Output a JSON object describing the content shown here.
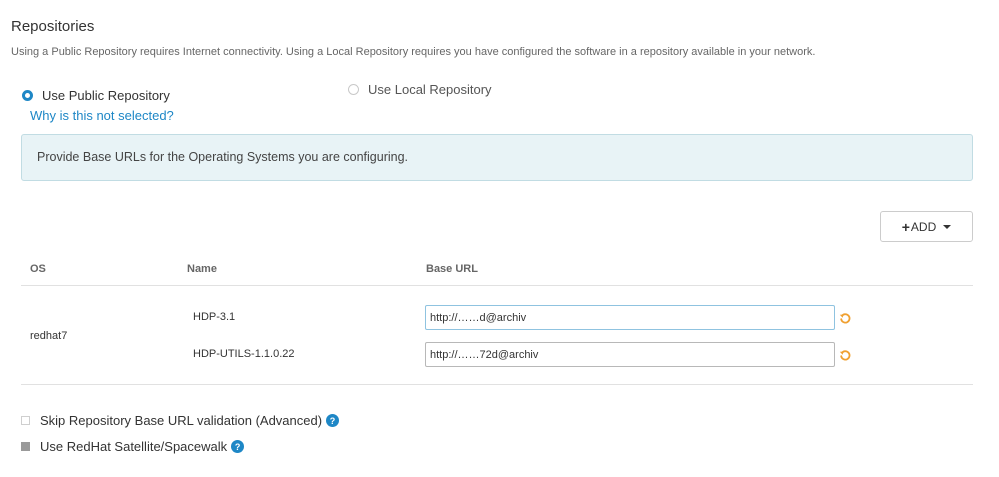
{
  "section": {
    "title": "Repositories",
    "description": "Using a Public Repository requires Internet connectivity. Using a Local Repository requires you have configured the software in a repository available in your network."
  },
  "repo_type": {
    "public_label": "Use Public Repository",
    "local_label": "Use Local Repository",
    "selected": "public",
    "why_link": "Why is this not selected?"
  },
  "info": {
    "message": "Provide Base URLs for the Operating Systems you are configuring."
  },
  "toolbar": {
    "add_label": "ADD"
  },
  "table": {
    "headers": {
      "os": "OS",
      "name": "Name",
      "base_url": "Base URL"
    },
    "os": "redhat7",
    "repos": [
      {
        "name": "HDP-3.1",
        "base_url": "http://……d@archiv"
      },
      {
        "name": "HDP-UTILS-1.1.0.22",
        "base_url": "http://……72d@archiv"
      }
    ]
  },
  "options": {
    "skip_validation_label": "Skip Repository Base URL validation (Advanced)",
    "satellite_label": "Use RedHat Satellite/Spacewalk",
    "help_glyph": "?"
  },
  "colors": {
    "accent": "#1e87c6",
    "info_bg": "#e8f3f6",
    "undo_icon": "#f0a030"
  }
}
